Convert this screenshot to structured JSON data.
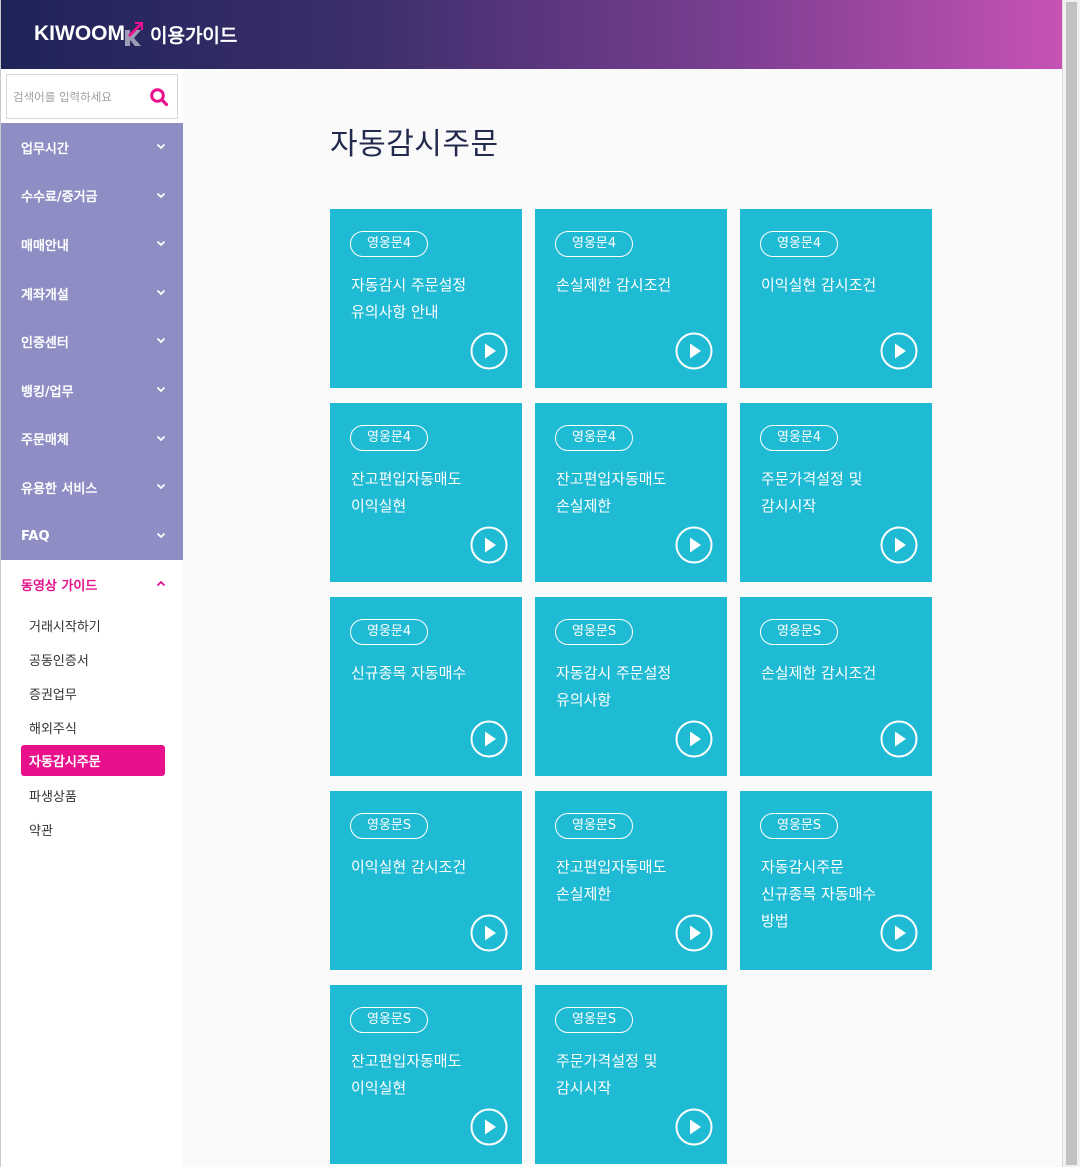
{
  "header": {
    "logo_text": "KIWOOM",
    "subtitle": "이용가이드"
  },
  "search": {
    "placeholder": "검색어를 입력하세요",
    "value": ""
  },
  "sidebar": {
    "menu": [
      {
        "label": "업무시간"
      },
      {
        "label": "수수료/증거금"
      },
      {
        "label": "매매안내"
      },
      {
        "label": "계좌개설"
      },
      {
        "label": "인증센터"
      },
      {
        "label": "뱅킹/업무"
      },
      {
        "label": "주문매체"
      },
      {
        "label": "유용한 서비스"
      },
      {
        "label": "FAQ"
      }
    ],
    "video_guide": {
      "label": "동영상 가이드",
      "items": [
        {
          "label": "거래시작하기"
        },
        {
          "label": "공동인증서"
        },
        {
          "label": "증권업무"
        },
        {
          "label": "해외주식"
        },
        {
          "label": "자동감시주문",
          "active": true
        },
        {
          "label": "파생상품"
        },
        {
          "label": "약관"
        }
      ]
    }
  },
  "main": {
    "title": "자동감시주문",
    "cards": [
      {
        "badge": "영웅문4",
        "title": "자동감시 주문설정\n유의사항 안내"
      },
      {
        "badge": "영웅문4",
        "title": "손실제한 감시조건"
      },
      {
        "badge": "영웅문4",
        "title": "이익실현 감시조건"
      },
      {
        "badge": "영웅문4",
        "title": "잔고편입자동매도\n이익실현"
      },
      {
        "badge": "영웅문4",
        "title": "잔고편입자동매도\n손실제한"
      },
      {
        "badge": "영웅문4",
        "title": "주문가격설정 및\n감시시작"
      },
      {
        "badge": "영웅문4",
        "title": "신규종목 자동매수"
      },
      {
        "badge": "영웅문S",
        "title": "자동감시 주문설정\n유의사항"
      },
      {
        "badge": "영웅문S",
        "title": "손실제한 감시조건"
      },
      {
        "badge": "영웅문S",
        "title": "이익실현 감시조건"
      },
      {
        "badge": "영웅문S",
        "title": "잔고편입자동매도\n손실제한"
      },
      {
        "badge": "영웅문S",
        "title": "자동감시주문\n신규종목 자동매수\n방법"
      },
      {
        "badge": "영웅문S",
        "title": "잔고편입자동매도\n이익실현"
      },
      {
        "badge": "영웅문S",
        "title": "주문가격설정 및\n감시시작"
      }
    ]
  },
  "colors": {
    "accent_pink": "#e8108b",
    "card_cyan": "#1fbad3",
    "menu_purple": "#8e8ec4",
    "header_start": "#1e2358",
    "header_end": "#c652b4"
  },
  "icons": {
    "search": "search-icon",
    "chevron": "chevron-down-icon",
    "play": "play-icon"
  }
}
